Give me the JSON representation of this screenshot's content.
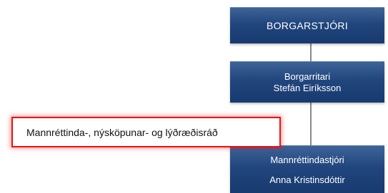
{
  "org_chart": {
    "mayor": {
      "title": "BORGARSTJÓRI"
    },
    "city_secretary": {
      "title": "Borgarritari",
      "name": "Stefán Eiríksson"
    },
    "human_rights_director": {
      "title": "Mannréttindastjóri",
      "name": "Anna Kristinsdóttir"
    }
  },
  "council": {
    "label": "Mannréttinda-, nýsköpunar- og lýðræðisráð"
  },
  "colors": {
    "box_fill": "#1f427a",
    "connector": "#8a8a8a",
    "highlight_border": "#f30d0d"
  }
}
